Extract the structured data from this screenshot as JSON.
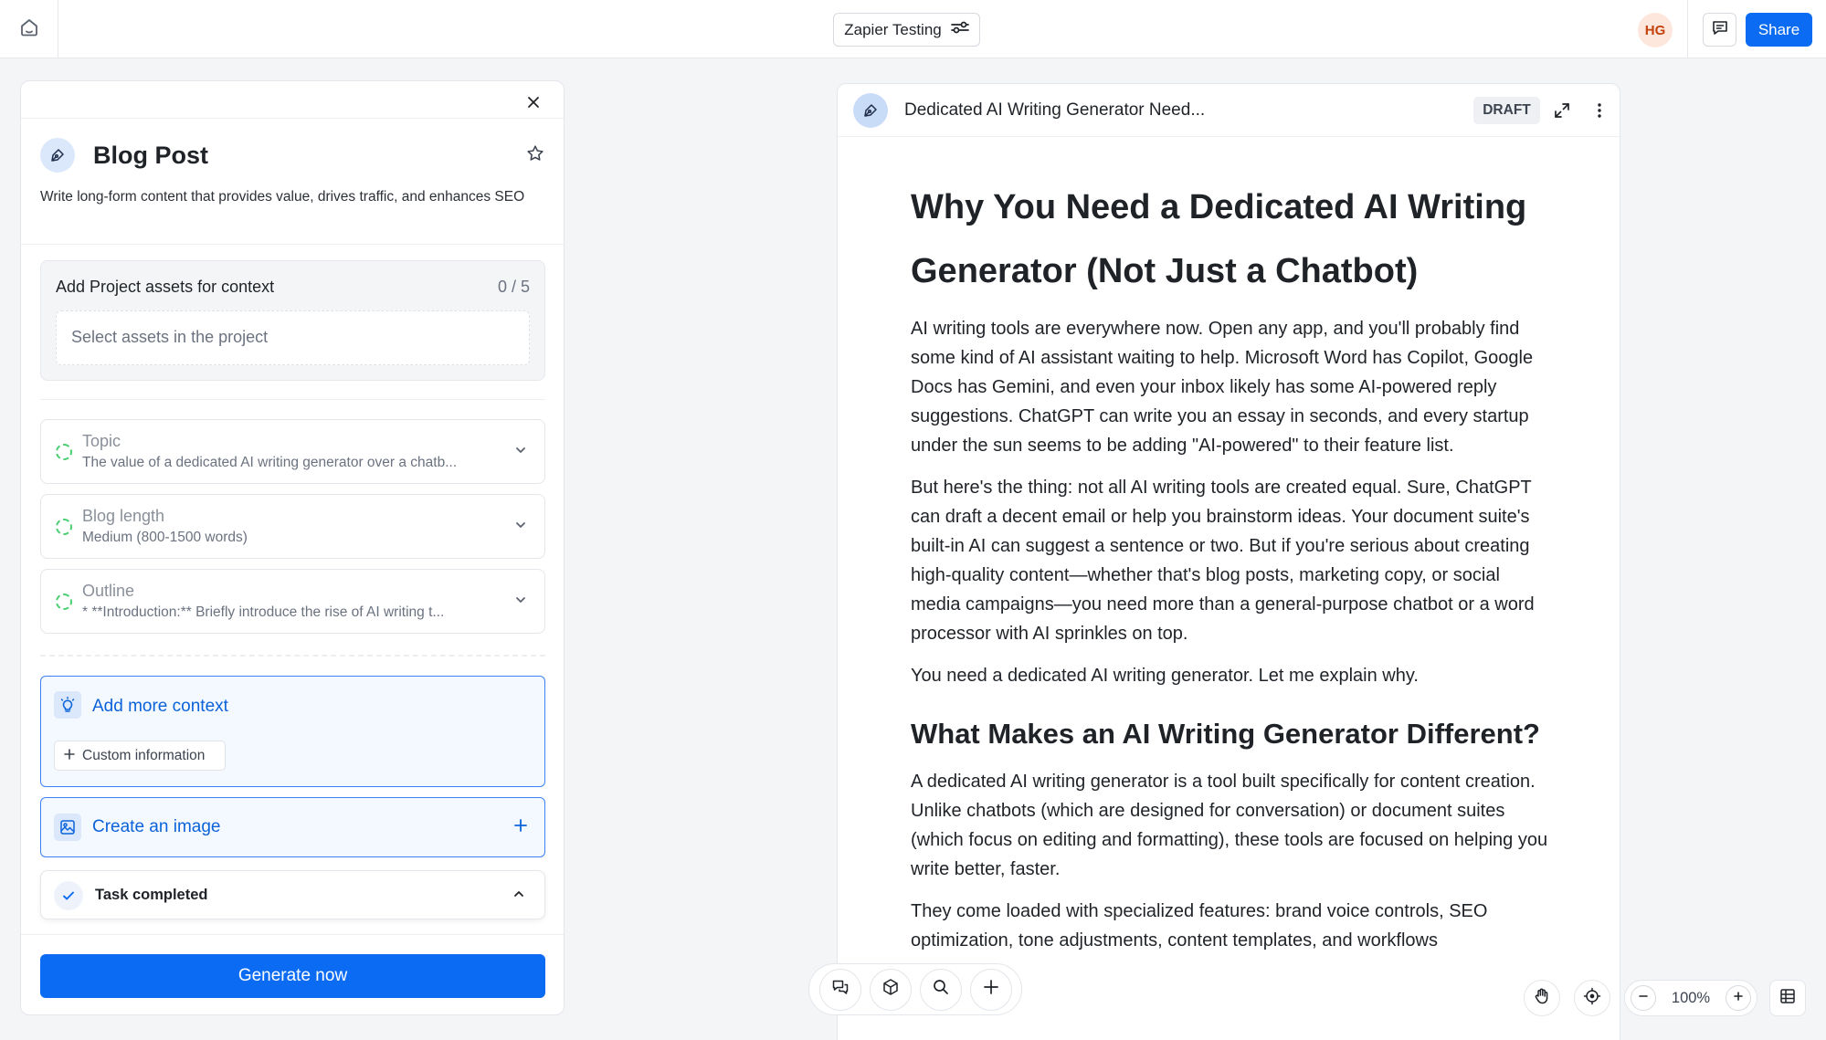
{
  "topbar": {
    "project_name": "Zapier Testing",
    "avatar_initials": "HG",
    "share_label": "Share"
  },
  "panel": {
    "title": "Blog Post",
    "description": "Write long-form content that provides value, drives traffic, and enhances SEO",
    "assets": {
      "label": "Add Project assets for context",
      "count": "0 / 5",
      "placeholder": "Select assets in the project"
    },
    "fields": [
      {
        "label": "Topic",
        "value": "The value of a dedicated AI writing generator over a chatb..."
      },
      {
        "label": "Blog length",
        "value": "Medium (800-1500 words)"
      },
      {
        "label": "Outline",
        "value": "* **Introduction:** Briefly introduce the rise of AI writing t..."
      }
    ],
    "add_context_label": "Add more context",
    "custom_info_label": "Custom information",
    "create_image_label": "Create an image",
    "task_status": "Task completed",
    "generate_label": "Generate now"
  },
  "document": {
    "title": "Dedicated AI Writing Generator Need...",
    "badge": "DRAFT",
    "heading1": "Why You Need a Dedicated AI Writing Generator (Not Just a Chatbot)",
    "paragraphs": [
      "AI writing tools are everywhere now. Open any app, and you'll probably find some kind of AI assistant waiting to help. Microsoft Word has Copilot, Google Docs has Gemini, and even your inbox likely has some AI-powered reply suggestions. ChatGPT can write you an essay in seconds, and every startup under the sun seems to be adding \"AI-powered\" to their feature list.",
      "But here's the thing: not all AI writing tools are created equal. Sure, ChatGPT can draft a decent email or help you brainstorm ideas. Your document suite's built-in AI can suggest a sentence or two. But if you're serious about creating high-quality content—whether that's blog posts, marketing copy, or social media campaigns—you need more than a general-purpose chatbot or a word processor with AI sprinkles on top.",
      "You need a dedicated AI writing generator. Let me explain why."
    ],
    "heading2": "What Makes an AI Writing Generator Different?",
    "paragraphs2": [
      "A dedicated AI writing generator is a tool built specifically for content creation. Unlike chatbots (which are designed for conversation) or document suites (which focus on editing and formatting), these tools are focused on helping you write better, faster.",
      "They come loaded with specialized features: brand voice controls, SEO optimization, tone adjustments, content templates, and workflows"
    ]
  },
  "zoom": {
    "level": "100%"
  },
  "icons": {
    "home": "home-icon",
    "settings": "sliders-icon",
    "comment": "comment-icon",
    "close": "close-icon",
    "pen": "pen-nib-icon",
    "star": "star-icon",
    "chevron": "chevron-down-icon",
    "lightbulb": "lightbulb-icon",
    "image": "image-icon",
    "check": "check-icon"
  },
  "colors": {
    "accent": "#0b6bf2",
    "accent_text": "#0b63d9",
    "status_dot": "#4ccf73"
  }
}
